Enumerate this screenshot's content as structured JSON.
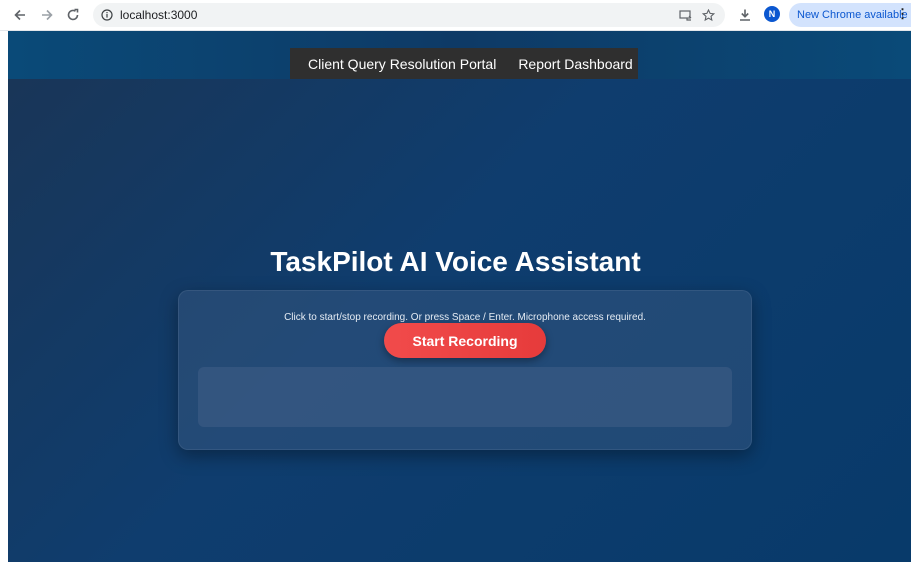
{
  "browser": {
    "url": "localhost:3000",
    "avatar_letter": "N",
    "update_label": "New Chrome available",
    "icons": [
      "back-icon",
      "forward-icon",
      "reload-icon",
      "site-info-icon",
      "cast-icon",
      "bookmark-star-icon",
      "download-icon",
      "kebab-menu-icon"
    ]
  },
  "nav": {
    "items": [
      {
        "label": "Client Query Resolution Portal"
      },
      {
        "label": "Report Dashboard"
      }
    ]
  },
  "main": {
    "title": "TaskPilot AI Voice Assistant",
    "hint": "Click to start/stop recording. Or press Space / Enter. Microphone access required.",
    "record_label": "Start Recording",
    "transcript": ""
  },
  "colors": {
    "accent_red": "#f14b4b",
    "background_navy": "#0f3d6e",
    "nav_bar": "#2f2f2f"
  }
}
